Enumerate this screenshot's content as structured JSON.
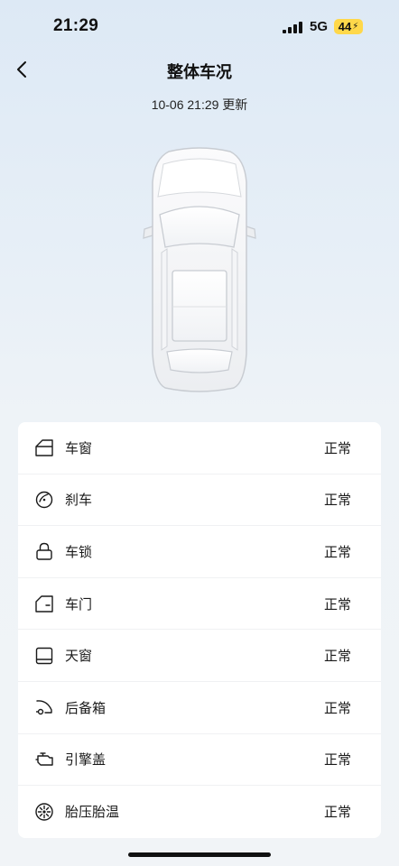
{
  "status_bar": {
    "time": "21:29",
    "network": "5G",
    "battery": "44",
    "battery_color": "#ffd84a"
  },
  "header": {
    "title": "整体车况"
  },
  "update": {
    "text": "10-06 21:29 更新"
  },
  "status_items": [
    {
      "icon": "car-window-icon",
      "label": "车窗",
      "status": "正常"
    },
    {
      "icon": "brake-icon",
      "label": "刹车",
      "status": "正常"
    },
    {
      "icon": "lock-icon",
      "label": "车锁",
      "status": "正常"
    },
    {
      "icon": "car-door-icon",
      "label": "车门",
      "status": "正常"
    },
    {
      "icon": "sunroof-icon",
      "label": "天窗",
      "status": "正常"
    },
    {
      "icon": "trunk-icon",
      "label": "后备箱",
      "status": "正常"
    },
    {
      "icon": "engine-icon",
      "label": "引擎盖",
      "status": "正常"
    },
    {
      "icon": "tire-icon",
      "label": "胎压胎温",
      "status": "正常"
    }
  ]
}
